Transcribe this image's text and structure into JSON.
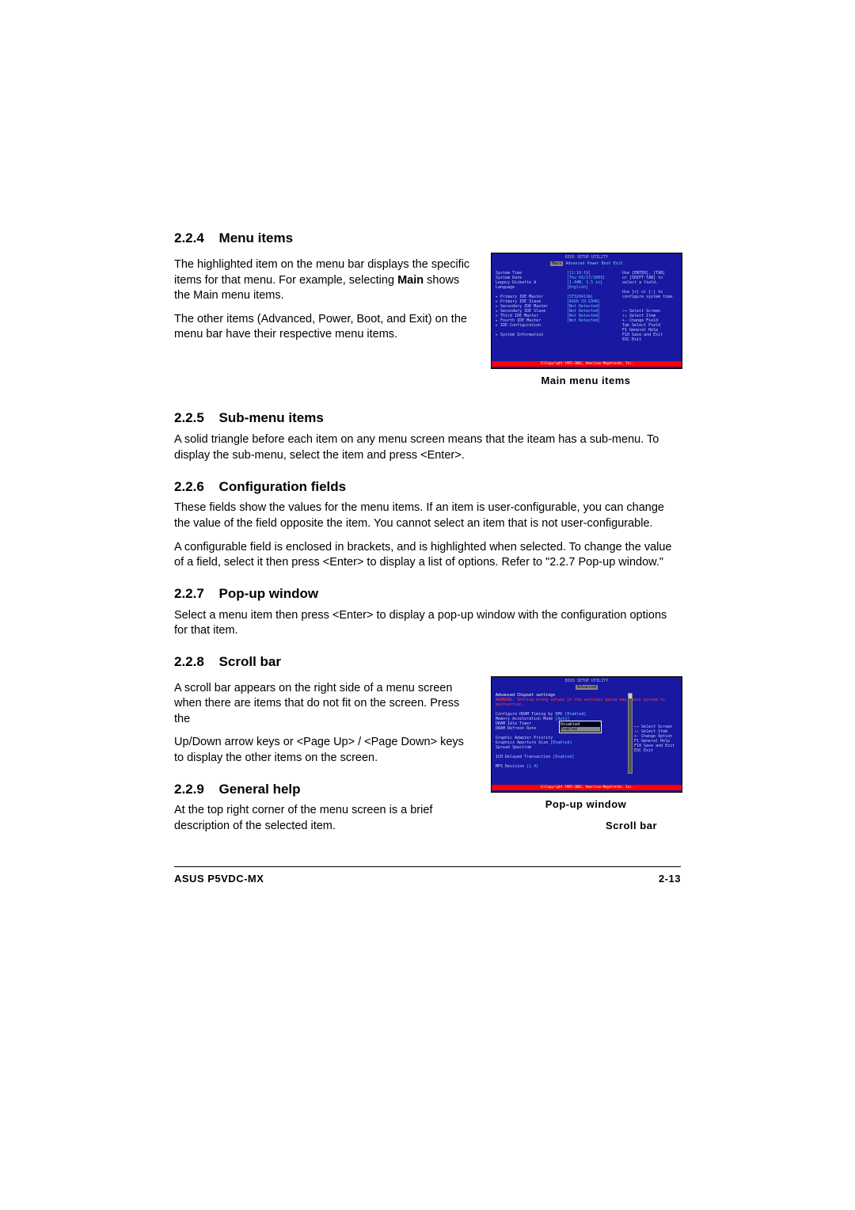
{
  "sections": {
    "s224": {
      "num": "2.2.4",
      "title": "Menu items",
      "p1a": "The highlighted item on the menu bar displays the specific items for that menu. For example, selecting ",
      "p1bold": "Main",
      "p1b": " shows the Main menu items.",
      "p2": "The other items (Advanced, Power, Boot, and Exit) on the menu bar have their respective menu items."
    },
    "s225": {
      "num": "2.2.5",
      "title": "Sub-menu items",
      "p1": "A solid triangle before each item on any menu screen means that the iteam has a sub-menu. To display the sub-menu, select the item and press <Enter>."
    },
    "s226": {
      "num": "2.2.6",
      "title": "Configuration fields",
      "p1": "These fields show the values for the menu items. If an item is user-configurable, you can change the value of the field opposite the item. You cannot select an item that is not user-configurable.",
      "p2": "A configurable field is enclosed in brackets, and is highlighted when selected. To change the value of a field, select it then press <Enter> to display a list of options. Refer to \"2.2.7 Pop-up window.\""
    },
    "s227": {
      "num": "2.2.7",
      "title": "Pop-up window",
      "p1": "Select a menu item then press <Enter> to display a pop-up window with the configuration options for that item."
    },
    "s228": {
      "num": "2.2.8",
      "title": "Scroll bar",
      "p1": "A scroll bar appears on the right side of a menu screen when there are items that do not fit on the screen. Press the",
      "p2": "Up/Down arrow keys or <Page Up> / <Page Down> keys to display the other items on the screen."
    },
    "s229": {
      "num": "2.2.9",
      "title": "General help",
      "p1": "At the top right corner of the menu screen is a brief description of the selected item."
    }
  },
  "captions": {
    "c1": "Main menu items",
    "c2": "Pop-up window",
    "c3": "Scroll bar"
  },
  "bios1": {
    "title": "BIOS SETUP UTILITY",
    "tabs": [
      "Main",
      "Advanced",
      "Power",
      "Boot",
      "Exit"
    ],
    "left": [
      "System Time",
      "System Date",
      "Legacy Diskette A",
      "Language",
      "",
      "▸ Primary IDE Master",
      "▸ Primary IDE Slave",
      "▸ Secondary IDE Master",
      "▸ Secondary IDE Slave",
      "▸ Third IDE Master",
      "▸ Fourth IDE Master",
      "▸ IDE Configuration",
      "",
      "▸ System Information"
    ],
    "mid": [
      "[11:10:19]",
      "[Thu 03/27/2003]",
      "[1.44M, 3.5 in]",
      "[English]",
      "",
      "[ST320413A]",
      "[ASUS CD-S340]",
      "[Not Detected]",
      "[Not Detected]",
      "[Not Detected]",
      "[Not Detected]"
    ],
    "right": [
      "Use [ENTER], [TAB]",
      "or [SHIFT-TAB] to",
      "select a field.",
      "",
      "Use [+] or [-] to",
      "configure system time.",
      "",
      "",
      "←→  Select Screen",
      "↑↓  Select Item",
      "+-   Change Field",
      "Tab  Select Field",
      "F1   General Help",
      "F10  Save and Exit",
      "ESC  Exit"
    ],
    "footer": "(C)Copyright 1985-2002, American Megatrends, Inc."
  },
  "bios2": {
    "title": "BIOS SETUP UTILITY",
    "tab": "Advanced",
    "heading": "Advanced Chipset settings",
    "warning": "WARNING: Setting wrong values in the sections below may cause system to malfunction.",
    "items": [
      [
        "Configure DRAM Timing by SPD",
        "[Enabled]"
      ],
      [
        "Memory Acceleration Mode",
        "[Auto]"
      ],
      [
        "DRAM Idle Timer",
        ""
      ],
      [
        "DRAM Refresh Rate",
        ""
      ],
      [
        "",
        ""
      ],
      [
        "Graphic Adapter Priority",
        ""
      ],
      [
        "Graphics Aperture Size",
        "[Enabled]"
      ],
      [
        "Spread Spectrum",
        ""
      ],
      [
        "",
        ""
      ],
      [
        "ICH Delayed Transaction",
        "[Enabled]"
      ],
      [
        "",
        ""
      ],
      [
        "MPS Revision",
        "[1.4]"
      ]
    ],
    "popup": [
      "Disabled",
      "Enabled"
    ],
    "right": [
      "←→  Select Screen",
      "↑↓  Select Item",
      "+-   Change Option",
      "F1   General Help",
      "F10  Save and Exit",
      "ESC  Exit"
    ],
    "footer": "(C)Copyright 1985-2002, American Megatrends, Inc."
  },
  "footer": {
    "left": "ASUS P5VDC-MX",
    "right": "2-13"
  }
}
